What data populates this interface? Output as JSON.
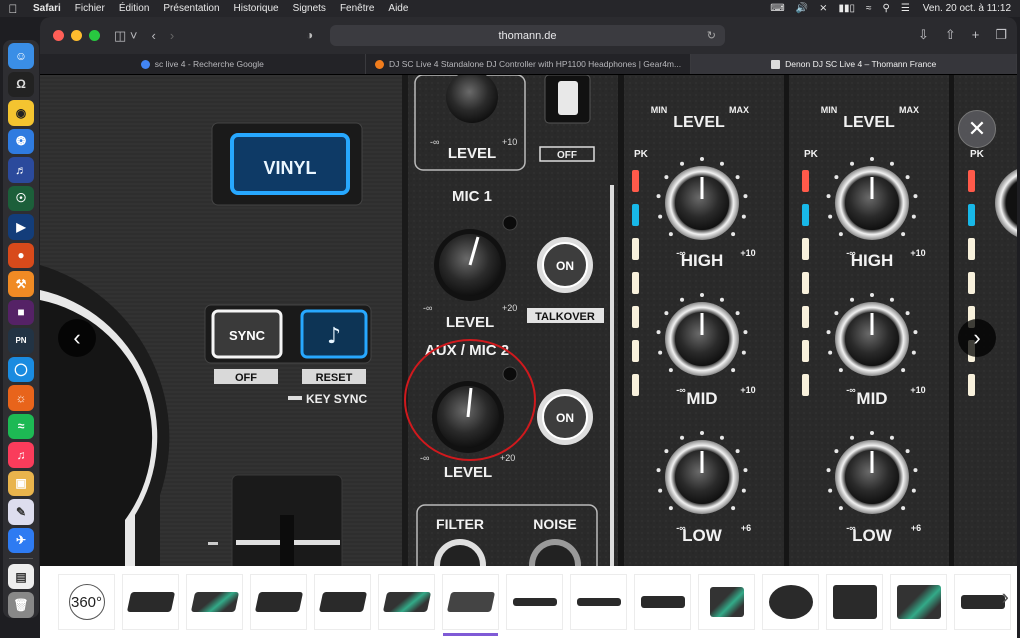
{
  "menubar": {
    "app": "Safari",
    "menus": [
      "Fichier",
      "Édition",
      "Présentation",
      "Historique",
      "Signets",
      "Fenêtre",
      "Aide"
    ],
    "clock": "Ven. 20 oct. à  11:12"
  },
  "browser": {
    "address": "thomann.de",
    "tabs": [
      {
        "title": "sc live 4 - Recherche Google",
        "fav_color": "#4285f4"
      },
      {
        "title": "DJ SC Live 4 Standalone DJ Controller with HP1100 Headphones | Gear4m...",
        "fav_color": "#f07c1c"
      },
      {
        "title": "Denon DJ SC Live 4 – Thomann France",
        "fav_color": "#dddddd"
      }
    ]
  },
  "device_labels": {
    "vinyl": "VINYL",
    "sync": "SYNC",
    "off": "OFF",
    "reset": "RESET",
    "key_sync": "KEY SYNC",
    "level": "LEVEL",
    "mic1": "MIC 1",
    "aux_mic2": "AUX / MIC 2",
    "talkover": "TALKOVER",
    "on": "ON",
    "filter": "FILTER",
    "noise": "NOISE",
    "high": "HIGH",
    "mid": "MID",
    "low": "LOW",
    "min": "MIN",
    "max": "MAX",
    "pk": "PK",
    "minus_inf": "-∞",
    "plus10": "+10",
    "plus20": "+20",
    "plus6": "+6"
  },
  "thumbnails": {
    "spin_label": "360°",
    "count": 15,
    "active_index": 6
  }
}
